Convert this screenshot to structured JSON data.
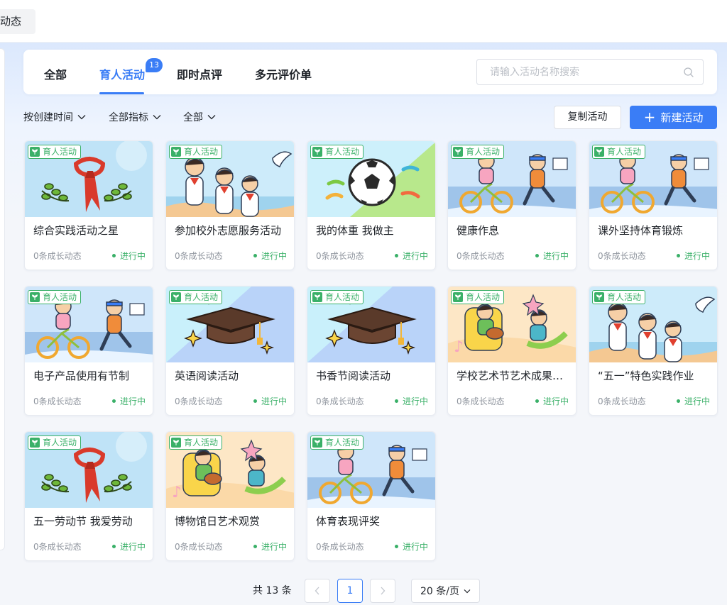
{
  "page_tab": {
    "label": "动态"
  },
  "tabs": [
    {
      "label": "全部",
      "active": false
    },
    {
      "label": "育人活动",
      "active": true,
      "badge": "13"
    },
    {
      "label": "即时点评",
      "active": false
    },
    {
      "label": "多元评价单",
      "active": false
    }
  ],
  "search": {
    "placeholder": "请输入活动名称搜索",
    "value": ""
  },
  "filters": [
    {
      "label": "按创建时间"
    },
    {
      "label": "全部指标"
    },
    {
      "label": "全部"
    }
  ],
  "toolbar": {
    "copy_label": "复制活动",
    "new_label": "新建活动",
    "accent": "#3a7df6"
  },
  "tag_label": "育人活动",
  "status_color": "#3ab068",
  "cards": [
    {
      "title": "综合实践活动之星",
      "count": "0条成长动态",
      "status": "进行中",
      "image": "red-scarf-icon"
    },
    {
      "title": "参加校外志愿服务活动",
      "count": "0条成长动态",
      "status": "进行中",
      "image": "students-dove-icon"
    },
    {
      "title": "我的体重 我做主",
      "count": "0条成长动态",
      "status": "进行中",
      "image": "soccer-ball-icon"
    },
    {
      "title": "健康作息",
      "count": "0条成长动态",
      "status": "进行中",
      "image": "kids-cycling-icon"
    },
    {
      "title": "课外坚持体育锻炼",
      "count": "0条成长动态",
      "status": "进行中",
      "image": "kids-cycling-icon"
    },
    {
      "title": "电子产品使用有节制",
      "count": "0条成长动态",
      "status": "进行中",
      "image": "kids-cycling-icon"
    },
    {
      "title": "英语阅读活动",
      "count": "0条成长动态",
      "status": "进行中",
      "image": "graduation-cap-icon"
    },
    {
      "title": "书香节阅读活动",
      "count": "0条成长动态",
      "status": "进行中",
      "image": "graduation-cap-icon"
    },
    {
      "title": "学校艺术节艺术成果展示",
      "count": "0条成长动态",
      "status": "进行中",
      "image": "music-kids-icon"
    },
    {
      "title": "“五一”特色实践作业",
      "count": "0条成长动态",
      "status": "进行中",
      "image": "students-dove-icon"
    },
    {
      "title": "五一劳动节 我爱劳动",
      "count": "0条成长动态",
      "status": "进行中",
      "image": "red-scarf-icon"
    },
    {
      "title": "博物馆日艺术观赏",
      "count": "0条成长动态",
      "status": "进行中",
      "image": "music-kids-icon"
    },
    {
      "title": "体育表现评奖",
      "count": "0条成长动态",
      "status": "进行中",
      "image": "kids-cycling-icon"
    }
  ],
  "pagination": {
    "total_label": "共 13 条",
    "current_page": "1",
    "page_size_label": "20 条/页"
  }
}
